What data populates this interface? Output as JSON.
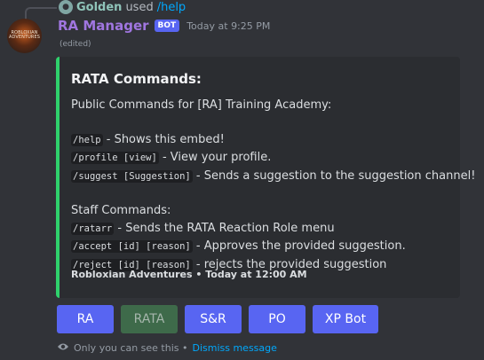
{
  "reply": {
    "user": "Golden",
    "used_text": "used",
    "command": "/help"
  },
  "message": {
    "author": "RA Manager",
    "badge": "BOT",
    "timestamp": "Today at 9:25 PM",
    "edited": "(edited)",
    "avatar_text": "ROBLOXIAN ADVENTURES"
  },
  "embed": {
    "accent_color": "#2fd16c",
    "title": "RATA Commands:",
    "intro": "Public Commands for [RA] Training Academy:",
    "public_commands": [
      {
        "cmd": "/help",
        "desc": " - Shows this embed!"
      },
      {
        "cmd": "/profile [view]",
        "desc": " - View your profile."
      },
      {
        "cmd": "/suggest [Suggestion]",
        "desc": " - Sends a suggestion to the suggestion channel!"
      }
    ],
    "staff_heading": "Staff Commands:",
    "staff_commands": [
      {
        "cmd": "/ratarr",
        "desc": " - Sends the RATA Reaction Role menu"
      },
      {
        "cmd": "/accept [id] [reason]",
        "desc": " - Approves the provided suggestion."
      },
      {
        "cmd": "/reject [id] [reason]",
        "desc": " - rejects the provided suggestion"
      }
    ],
    "footer": "Robloxian Adventures • Today at 12:00 AM"
  },
  "buttons": [
    {
      "label": "RA",
      "style": "primary"
    },
    {
      "label": "RATA",
      "style": "success"
    },
    {
      "label": "S&R",
      "style": "primary"
    },
    {
      "label": "PO",
      "style": "primary"
    },
    {
      "label": "XP Bot",
      "style": "primary"
    }
  ],
  "notice": {
    "icon": "eye-icon",
    "text": "Only you can see this •",
    "dismiss": "Dismiss message"
  },
  "colors": {
    "background": "#313338",
    "embed_bg": "#2b2d31",
    "blurple": "#5865f2",
    "bot_name": "#a076e0",
    "link": "#00a8fc"
  }
}
